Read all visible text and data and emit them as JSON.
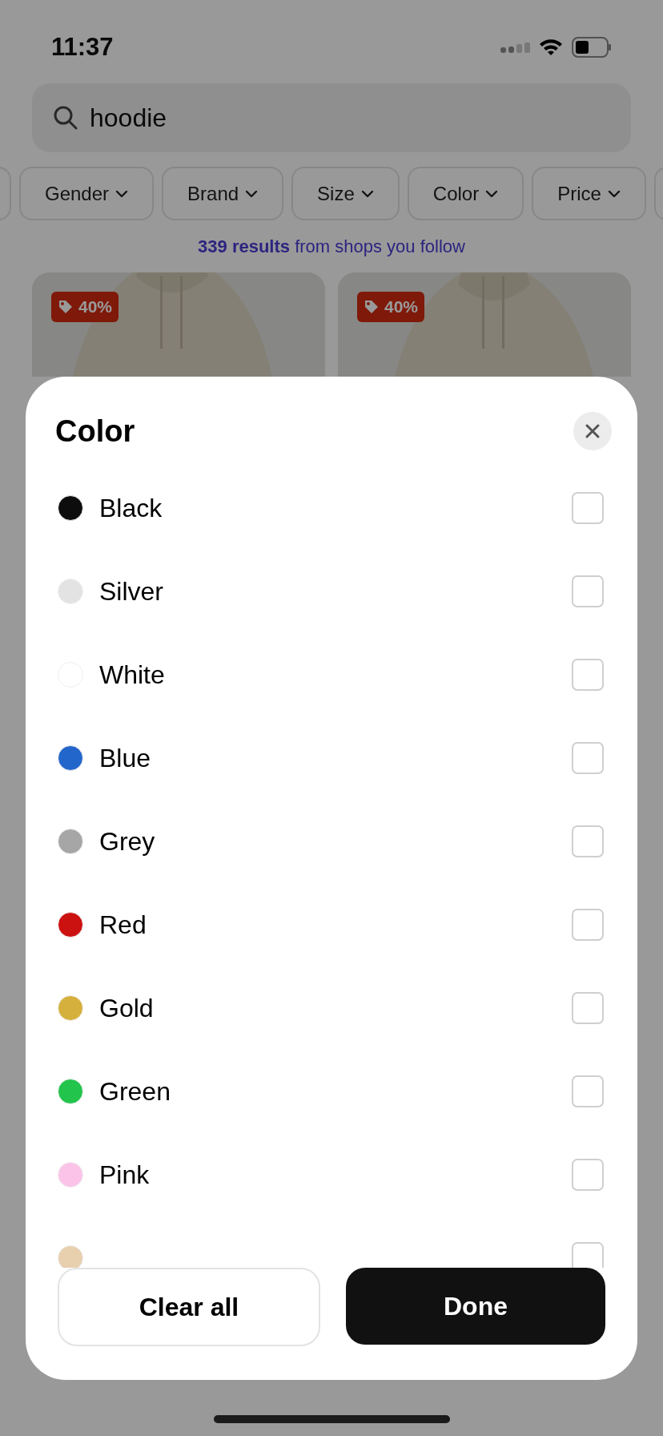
{
  "status_bar": {
    "time": "11:37"
  },
  "search": {
    "value": "hoodie"
  },
  "filters": [
    {
      "label": "Gender"
    },
    {
      "label": "Brand"
    },
    {
      "label": "Size"
    },
    {
      "label": "Color"
    },
    {
      "label": "Price"
    }
  ],
  "results": {
    "count": "339 results",
    "text": "from shops you follow"
  },
  "products": [
    {
      "badge": "40%"
    },
    {
      "badge": "40%"
    }
  ],
  "sheet": {
    "title": "Color",
    "options": [
      {
        "label": "Black",
        "color": "#0d0d0d",
        "checked": false
      },
      {
        "label": "Silver",
        "color": "#e3e3e3",
        "checked": false
      },
      {
        "label": "White",
        "color": "#ffffff",
        "checked": false
      },
      {
        "label": "Blue",
        "color": "#2266cc",
        "checked": false
      },
      {
        "label": "Grey",
        "color": "#a6a6a6",
        "checked": false
      },
      {
        "label": "Red",
        "color": "#cc1111",
        "checked": false
      },
      {
        "label": "Gold",
        "color": "#d6b03c",
        "checked": false
      },
      {
        "label": "Green",
        "color": "#22c44c",
        "checked": false
      },
      {
        "label": "Pink",
        "color": "#fbc3e8",
        "checked": false
      },
      {
        "color": "#e8cfae",
        "checked": false
      }
    ],
    "buttons": {
      "clear": "Clear all",
      "done": "Done"
    }
  }
}
